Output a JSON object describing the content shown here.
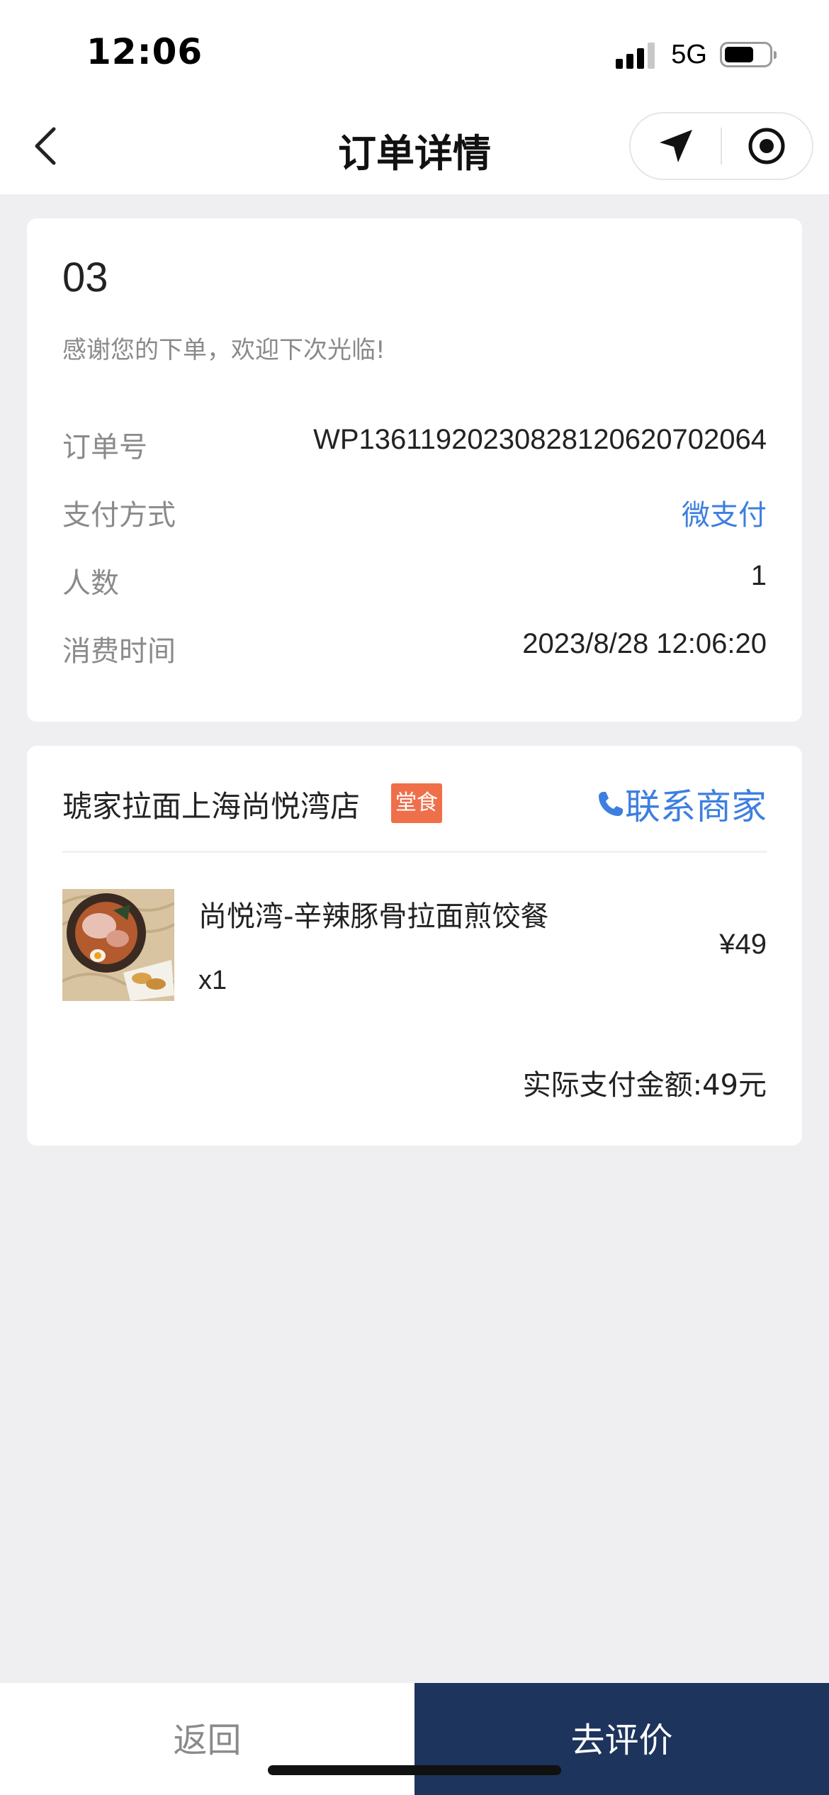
{
  "status_bar": {
    "time": "12:06",
    "network": "5G",
    "battery_fraction": 0.6
  },
  "nav": {
    "title": "订单详情",
    "back_icon": "chevron-left-icon",
    "capsule_icons": [
      "location-arrow-icon",
      "record-icon"
    ]
  },
  "order": {
    "number": "03",
    "thanks": "感谢您的下单，欢迎下次光临!",
    "rows": [
      {
        "label": "订单号",
        "value": "WP1361192023082812062070 2064"
      },
      {
        "label": "支付方式",
        "value": "微支付"
      },
      {
        "label": "人数",
        "value": "1"
      },
      {
        "label": "消费时间",
        "value": "2023/8/28 12:06:20"
      }
    ]
  },
  "shop": {
    "name": "琥家拉面上海尚悦湾店",
    "tag": "堂食",
    "contact_label": "联系商家",
    "item": {
      "name": "尚悦湾-辛辣豚骨拉面煎饺餐",
      "qty": "x1",
      "price": "¥49"
    },
    "total": "实际支付金额:49元"
  },
  "colors": {
    "accent": "#3d7fe0",
    "tag": "#ef6f4a",
    "primary_button": "#1d345c"
  },
  "footer": {
    "back_label": "返回",
    "review_label": "去评价"
  }
}
